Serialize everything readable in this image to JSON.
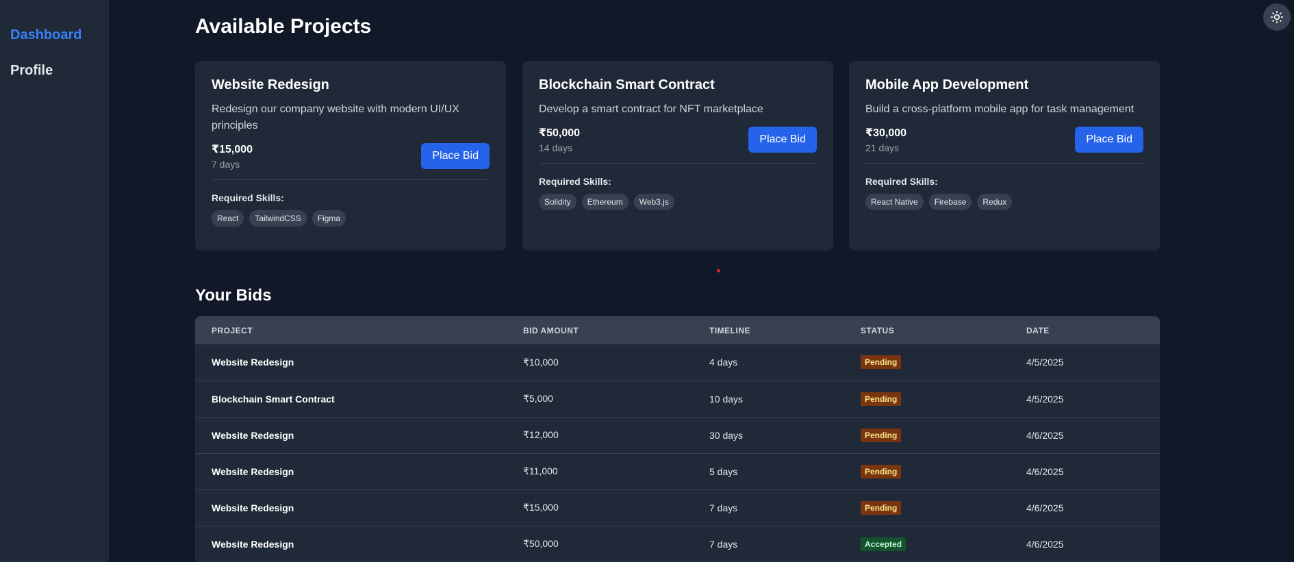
{
  "sidebar": {
    "items": [
      {
        "label": "Dashboard"
      },
      {
        "label": "Profile"
      }
    ]
  },
  "colors": {
    "accent": "#3b82f6",
    "button": "#2563eb",
    "pending_bg": "#78350f",
    "accepted_bg": "#14532d"
  },
  "header": {
    "title": "Available Projects"
  },
  "projects": [
    {
      "title": "Website Redesign",
      "description": "Redesign our company website with modern UI/UX principles",
      "budget": "₹15,000",
      "duration": "7 days",
      "button": "Place Bid",
      "skills_label": "Required Skills:",
      "skills": [
        "React",
        "TailwindCSS",
        "Figma"
      ]
    },
    {
      "title": "Blockchain Smart Contract",
      "description": "Develop a smart contract for NFT marketplace",
      "budget": "₹50,000",
      "duration": "14 days",
      "button": "Place Bid",
      "skills_label": "Required Skills:",
      "skills": [
        "Solidity",
        "Ethereum",
        "Web3.js"
      ]
    },
    {
      "title": "Mobile App Development",
      "description": "Build a cross-platform mobile app for task management",
      "budget": "₹30,000",
      "duration": "21 days",
      "button": "Place Bid",
      "skills_label": "Required Skills:",
      "skills": [
        "React Native",
        "Firebase",
        "Redux"
      ]
    }
  ],
  "bids": {
    "title": "Your Bids",
    "columns": [
      "PROJECT",
      "BID AMOUNT",
      "TIMELINE",
      "STATUS",
      "DATE"
    ],
    "rows": [
      {
        "project": "Website Redesign",
        "amount": "₹10,000",
        "timeline": "4 days",
        "status": "Pending",
        "date": "4/5/2025"
      },
      {
        "project": "Blockchain Smart Contract",
        "amount": "₹5,000",
        "timeline": "10 days",
        "status": "Pending",
        "date": "4/5/2025"
      },
      {
        "project": "Website Redesign",
        "amount": "₹12,000",
        "timeline": "30 days",
        "status": "Pending",
        "date": "4/6/2025"
      },
      {
        "project": "Website Redesign",
        "amount": "₹11,000",
        "timeline": "5 days",
        "status": "Pending",
        "date": "4/6/2025"
      },
      {
        "project": "Website Redesign",
        "amount": "₹15,000",
        "timeline": "7 days",
        "status": "Pending",
        "date": "4/6/2025"
      },
      {
        "project": "Website Redesign",
        "amount": "₹50,000",
        "timeline": "7 days",
        "status": "Accepted",
        "date": "4/6/2025"
      }
    ]
  },
  "icons": {
    "theme_toggle": "sun-icon"
  }
}
